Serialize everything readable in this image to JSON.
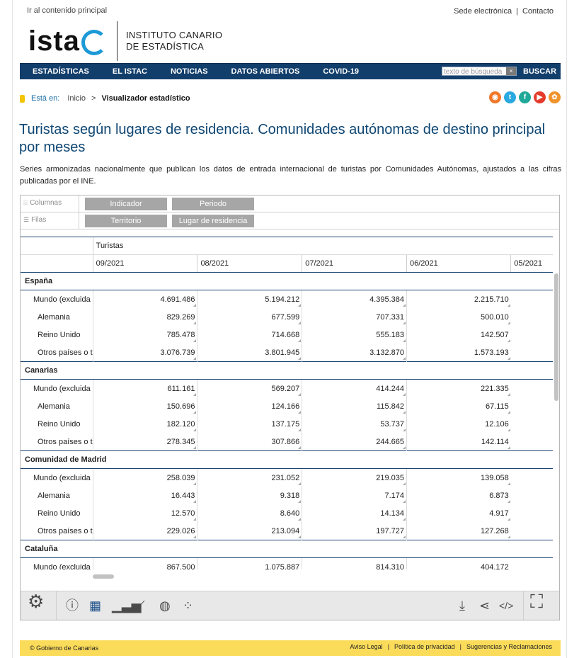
{
  "header": {
    "skip_link": "Ir al contenido principal",
    "top_links": [
      "Sede electrónica",
      "Contacto"
    ],
    "logo_word": "istac",
    "logo_text": [
      "INSTITUTO CANARIO",
      "DE ESTADÍSTICA"
    ]
  },
  "nav": {
    "items": [
      "ESTADÍSTICAS",
      "EL ISTAC",
      "NOTICIAS",
      "DATOS ABIERTOS",
      "COVID-19"
    ],
    "search_placeholder": "texto de búsqueda",
    "search_button": "BUSCAR"
  },
  "breadcrumb": {
    "label": "Está en:",
    "home": "Inicio",
    "separator": ">",
    "current": "Visualizador estadístico"
  },
  "social_icons": [
    "rss-icon",
    "twitter-icon",
    "flickr-icon",
    "youtube-icon",
    "slideshare-icon"
  ],
  "page": {
    "title": "Turistas según lugares de residencia. Comunidades autónomas de destino principal por meses",
    "description": "Series armonizadas nacionalmente que publican los datos de entrada internacional de turistas por Comunidades Autónomas, ajustados a las cifras publicadas por el INE."
  },
  "viewer": {
    "columns_label": "Columnas",
    "rows_label": "Filas",
    "column_chips": [
      "Indicador",
      "Periodo"
    ],
    "row_chips": [
      "Territorio",
      "Lugar de residencia"
    ],
    "indicator": "Turistas",
    "periods": [
      "09/2021",
      "08/2021",
      "07/2021",
      "06/2021",
      "05/2021"
    ],
    "regions": [
      {
        "name": "España",
        "rows": [
          {
            "label": "Mundo (excluida",
            "values": [
              "4.691.486",
              "5.194.212",
              "4.395.384",
              "2.215.710",
              ""
            ]
          },
          {
            "label": "Alemania",
            "values": [
              "829.269",
              "677.599",
              "707.331",
              "500.010",
              ""
            ]
          },
          {
            "label": "Reino Unido",
            "values": [
              "785.478",
              "714.668",
              "555.183",
              "142.507",
              ""
            ]
          },
          {
            "label": "Otros países o t",
            "values": [
              "3.076.739",
              "3.801.945",
              "3.132.870",
              "1.573.193",
              ""
            ]
          }
        ]
      },
      {
        "name": "Canarias",
        "rows": [
          {
            "label": "Mundo (excluida",
            "values": [
              "611.161",
              "569.207",
              "414.244",
              "221.335",
              ""
            ]
          },
          {
            "label": "Alemania",
            "values": [
              "150.696",
              "124.166",
              "115.842",
              "67.115",
              ""
            ]
          },
          {
            "label": "Reino Unido",
            "values": [
              "182.120",
              "137.175",
              "53.737",
              "12.106",
              ""
            ]
          },
          {
            "label": "Otros países o t",
            "values": [
              "278.345",
              "307.866",
              "244.665",
              "142.114",
              ""
            ]
          }
        ]
      },
      {
        "name": "Comunidad de Madrid",
        "rows": [
          {
            "label": "Mundo (excluida",
            "values": [
              "258.039",
              "231.052",
              "219.035",
              "139.058",
              ""
            ]
          },
          {
            "label": "Alemania",
            "values": [
              "16.443",
              "9.318",
              "7.174",
              "6.873",
              ""
            ]
          },
          {
            "label": "Reino Unido",
            "values": [
              "12.570",
              "8.640",
              "14.134",
              "4.917",
              ""
            ]
          },
          {
            "label": "Otros países o t",
            "values": [
              "229.026",
              "213.094",
              "197.727",
              "127.268",
              ""
            ]
          }
        ]
      },
      {
        "name": "Cataluña",
        "rows": [
          {
            "label": "Mundo (excluida",
            "values": [
              "867.500",
              "1.075.887",
              "814.310",
              "404.172",
              ""
            ]
          }
        ]
      }
    ]
  },
  "toolbar_icons": [
    "settings-icon",
    "info-icon",
    "table-icon",
    "bar-chart-icon",
    "line-chart-icon",
    "map-icon",
    "bubble-map-icon",
    "download-icon",
    "share-icon",
    "embed-icon",
    "fullscreen-icon"
  ],
  "footer": {
    "copyright": "© Gobierno de Canarias",
    "links": [
      "Aviso Legal",
      "Política de privacidad",
      "Sugerencias y Reclamaciones"
    ]
  }
}
